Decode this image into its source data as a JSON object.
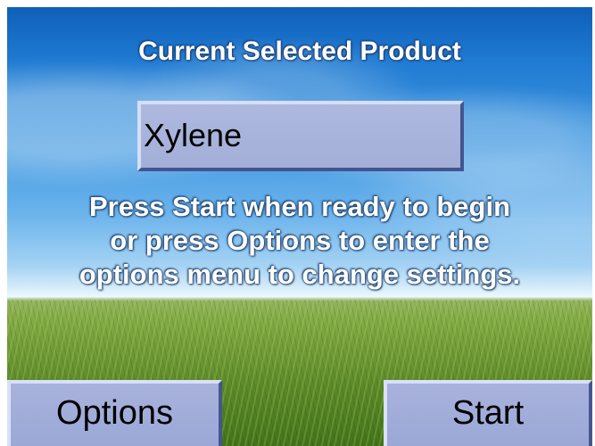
{
  "screen": {
    "title": "Current Selected Product",
    "selected_product": "Xylene",
    "instruction_lines": [
      "Press Start when ready to begin",
      "or press Options to enter the",
      "options menu to change settings."
    ]
  },
  "buttons": {
    "options_label": "Options",
    "start_label": "Start"
  },
  "colors": {
    "button_fill": "#a8b2dc",
    "field_fill": "#aeb8df",
    "text_on_background": "#ffffff"
  }
}
